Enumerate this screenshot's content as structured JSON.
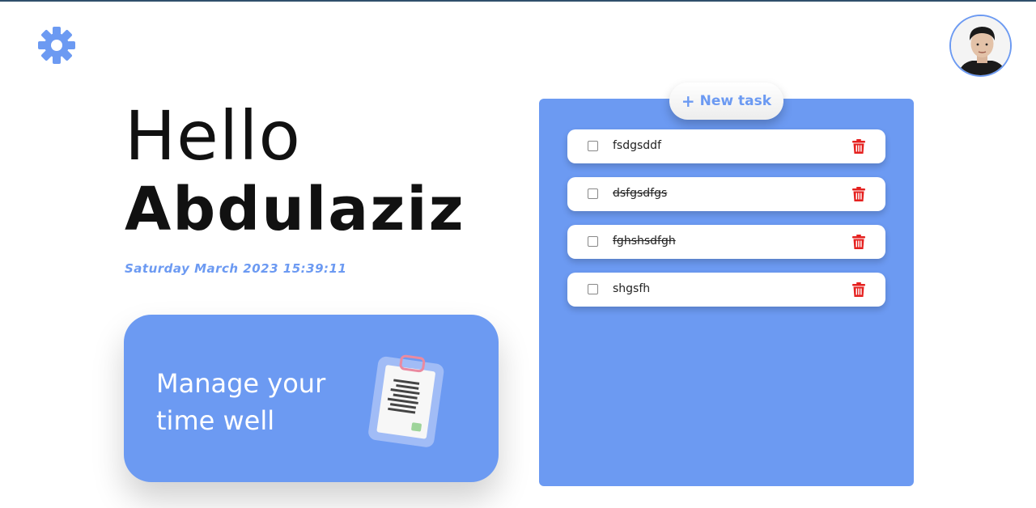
{
  "header": {
    "settings_icon": "gear-icon",
    "avatar_icon": "user-avatar"
  },
  "greeting": {
    "hello": "Hello",
    "name": "Abdulaziz",
    "datetime": "Saturday March 2023 15:39:11"
  },
  "promo": {
    "line1": "Manage your",
    "line2": "time well",
    "icon": "clipboard-icon"
  },
  "tasks_panel": {
    "new_task_label": "New task",
    "items": [
      {
        "label": "fsdgsddf",
        "completed": false
      },
      {
        "label": "dsfgsdfgs",
        "completed": true
      },
      {
        "label": "fghshsdfgh",
        "completed": true
      },
      {
        "label": "shgsfh",
        "completed": false
      }
    ]
  },
  "colors": {
    "accent": "#6c9af2",
    "delete": "#e5211f",
    "text": "#111111",
    "background": "#ffffff"
  }
}
